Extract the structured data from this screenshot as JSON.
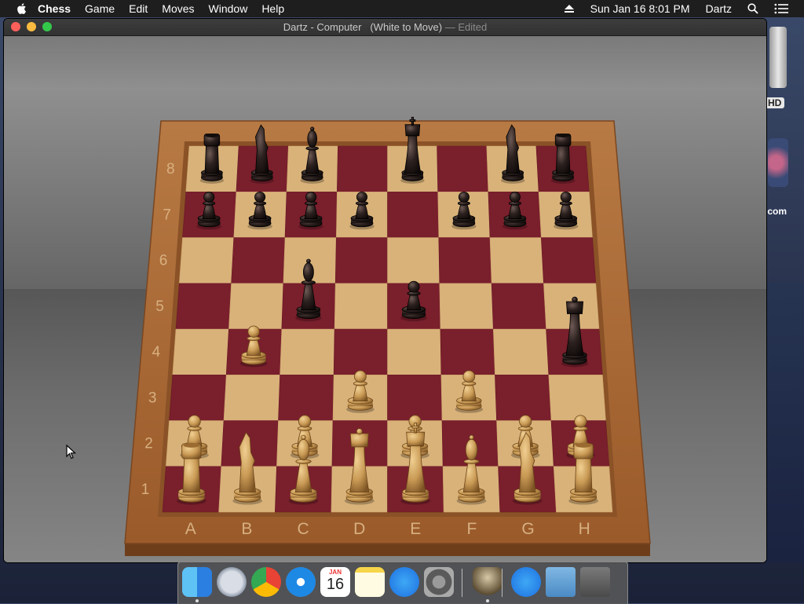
{
  "menubar": {
    "app_name": "Chess",
    "menus": [
      "Game",
      "Edit",
      "Moves",
      "Window",
      "Help"
    ],
    "datetime": "Sun Jan 16  8:01 PM",
    "user": "Dartz"
  },
  "window": {
    "title": "Dartz - Computer",
    "status": "(White to Move)",
    "edited": "— Edited"
  },
  "board": {
    "files": [
      "A",
      "B",
      "C",
      "D",
      "E",
      "F",
      "G",
      "H"
    ],
    "ranks": [
      "1",
      "2",
      "3",
      "4",
      "5",
      "6",
      "7",
      "8"
    ],
    "colors": {
      "dark_square": "#7a1f2c",
      "light_square": "#d9b27a",
      "frame": "#a86a36"
    },
    "black_pieces": [
      {
        "type": "rook",
        "square": "a8"
      },
      {
        "type": "knight",
        "square": "b8"
      },
      {
        "type": "bishop",
        "square": "c8"
      },
      {
        "type": "king",
        "square": "e8"
      },
      {
        "type": "knight",
        "square": "g8"
      },
      {
        "type": "rook",
        "square": "h8"
      },
      {
        "type": "pawn",
        "square": "a7"
      },
      {
        "type": "pawn",
        "square": "b7"
      },
      {
        "type": "pawn",
        "square": "c7"
      },
      {
        "type": "pawn",
        "square": "d7"
      },
      {
        "type": "pawn",
        "square": "f7"
      },
      {
        "type": "pawn",
        "square": "g7"
      },
      {
        "type": "pawn",
        "square": "h7"
      },
      {
        "type": "bishop",
        "square": "c5"
      },
      {
        "type": "pawn",
        "square": "e5"
      },
      {
        "type": "queen",
        "square": "h4"
      }
    ],
    "white_pieces": [
      {
        "type": "pawn",
        "square": "b4"
      },
      {
        "type": "pawn",
        "square": "d3"
      },
      {
        "type": "pawn",
        "square": "f3"
      },
      {
        "type": "pawn",
        "square": "a2"
      },
      {
        "type": "pawn",
        "square": "c2"
      },
      {
        "type": "pawn",
        "square": "e2"
      },
      {
        "type": "pawn",
        "square": "g2"
      },
      {
        "type": "pawn",
        "square": "h2"
      },
      {
        "type": "rook",
        "square": "a1"
      },
      {
        "type": "knight",
        "square": "b1"
      },
      {
        "type": "bishop",
        "square": "c1"
      },
      {
        "type": "queen",
        "square": "d1"
      },
      {
        "type": "king",
        "square": "e1"
      },
      {
        "type": "bishop",
        "square": "f1"
      },
      {
        "type": "knight",
        "square": "g1"
      },
      {
        "type": "rook",
        "square": "h1"
      }
    ]
  },
  "desktop": {
    "items": [
      {
        "label": "HD",
        "icon": "hard-drive-icon"
      },
      {
        "label": ".com",
        "icon": "app-icon"
      }
    ]
  },
  "dock": {
    "items": [
      {
        "name": "Finder",
        "icon": "finder-icon",
        "running": true
      },
      {
        "name": "Launchpad",
        "icon": "launchpad-icon",
        "running": false
      },
      {
        "name": "Chrome",
        "icon": "chrome-icon",
        "running": false
      },
      {
        "name": "Safari",
        "icon": "safari-icon",
        "running": false
      },
      {
        "name": "Calendar",
        "icon": "calendar-icon",
        "running": false,
        "month": "JAN",
        "day": "16"
      },
      {
        "name": "Notes",
        "icon": "notes-icon",
        "running": false
      },
      {
        "name": "App Store",
        "icon": "app-store-icon",
        "running": false
      },
      {
        "name": "System Preferences",
        "icon": "settings-icon",
        "running": false
      },
      {
        "name": "Chess",
        "icon": "chess-icon",
        "running": true
      },
      {
        "name": "Applications",
        "icon": "applications-folder-icon",
        "running": false
      },
      {
        "name": "Downloads",
        "icon": "downloads-folder-icon",
        "running": false
      },
      {
        "name": "Trash",
        "icon": "trash-icon",
        "running": false
      }
    ]
  }
}
